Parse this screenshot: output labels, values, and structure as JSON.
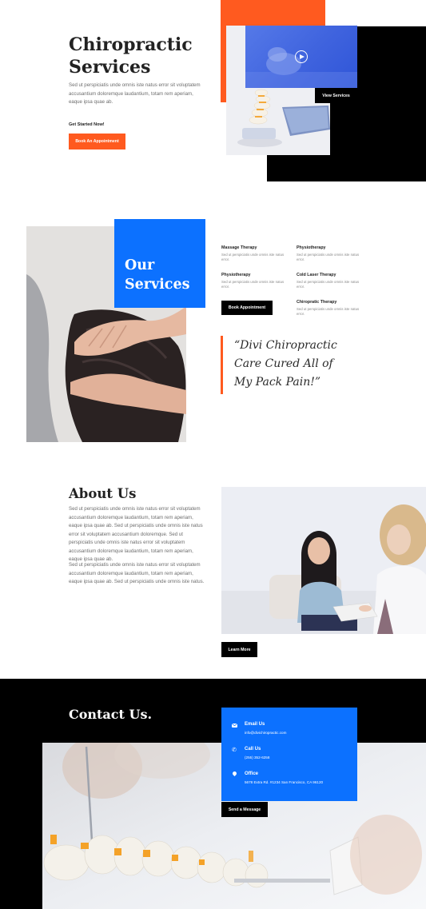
{
  "hero": {
    "title_line1": "Chiropractic",
    "title_line2": "Services",
    "description": "Sed ut perspiciatis unde omnis iste natus error sit voluptatem accusantium doloremque laudantium, totam rem aperiam, eaque ipsa quae ab.",
    "get_started": "Get Started Now!",
    "book_button": "Book An Appointment",
    "view_services_button": "View Services"
  },
  "services": {
    "heading_line1": "Our",
    "heading_line2": "Services",
    "items": [
      {
        "title": "Massage Therapy",
        "desc": "Sed ut perspiciatis unde omnis iste natus error."
      },
      {
        "title": "Physiotherapy",
        "desc": "Sed ut perspiciatis unde omnis iste natus error."
      },
      {
        "title": "Physiotherapy",
        "desc": "Sed ut perspiciatis unde omnis iste natus error."
      },
      {
        "title": "Cold Laser Therapy",
        "desc": "Sed ut perspiciatis unde omnis iste natus error."
      },
      {
        "title": "Chiropratic Therapy",
        "desc": "Sed ut perspiciatis unde omnis iste natus error."
      }
    ],
    "book_button": "Book Appointment",
    "quote": "“Divi Chiropractic Care Cured All of My Pack Pain!”"
  },
  "about": {
    "title": "About Us",
    "paragraph1": "Sed ut perspiciatis unde omnis iste natus error sit voluptatem accusantium doloremque laudantium, totam rem aperiam, eaque ipsa quae ab. Sed ut perspiciatis unde omnis iste natus error sit voluptatem accusantium doloremque. Sed ut perspiciatis unde omnis iste natus error sit voluptatem accusantium doloremque laudantium, totam rem aperiam, eaque ipsa quae ab.",
    "paragraph2": "Sed ut perspiciatis unde omnis iste natus error sit voluptatem accusantium doloremque laudantium, totam rem aperiam, eaque ipsa quae ab. Sed ut perspiciatis unde omnis iste natus.",
    "learn_more": "Learn More"
  },
  "contact": {
    "title": "Contact Us.",
    "email_label": "Email Us",
    "email_value": "info@divichiropractic.com",
    "call_label": "Call Us",
    "call_value": "(255) 352-6258",
    "office_label": "Office",
    "office_value": "5678 Extra Rd. #1234 San Francisco, CA 96120",
    "send_button": "Send a Message"
  },
  "colors": {
    "orange": "#ff5a1f",
    "blue": "#0c71ff",
    "black": "#000000"
  }
}
